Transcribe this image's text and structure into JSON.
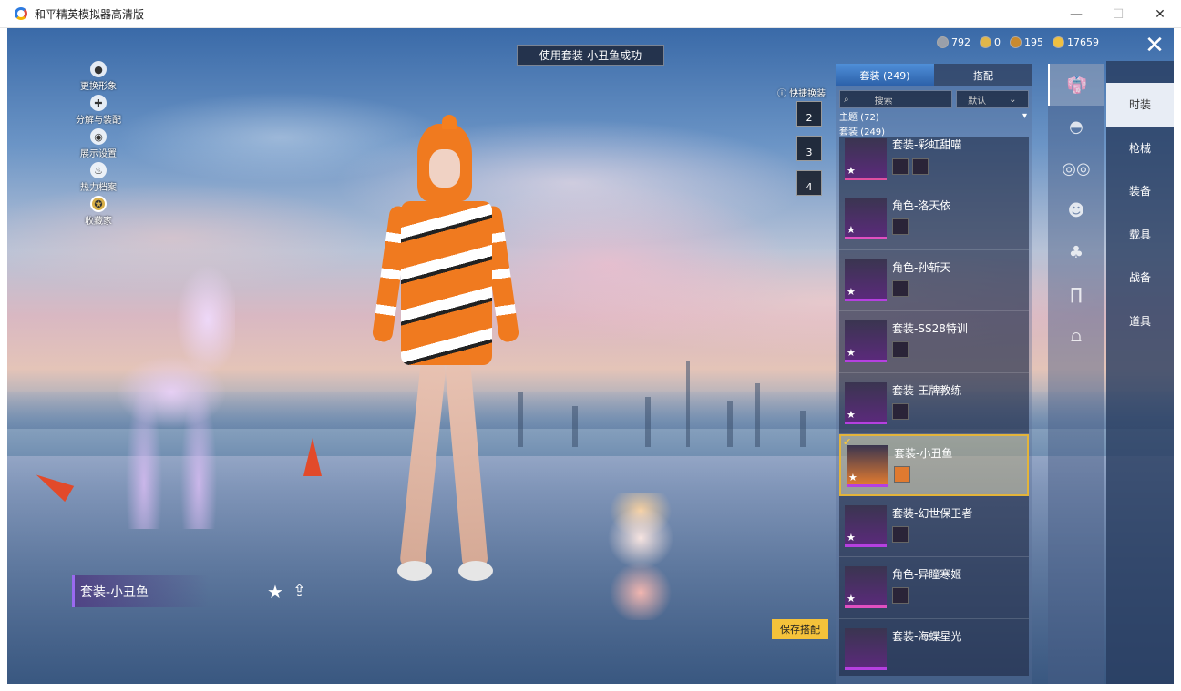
{
  "window": {
    "title": "和平精英模拟器高清版",
    "minimize": "—",
    "maximize": "☐",
    "close": "✕"
  },
  "game": {
    "notice": "使用套装-小丑鱼成功",
    "left_menu": [
      {
        "label": "更换形象",
        "icon": "person-icon"
      },
      {
        "label": "分解与装配",
        "icon": "puzzle-icon"
      },
      {
        "label": "展示设置",
        "icon": "eye-icon"
      },
      {
        "label": "热力档案",
        "icon": "flame-icon"
      },
      {
        "label": "收藏家",
        "icon": "collector-badge-icon"
      }
    ],
    "currency": [
      {
        "value": "792",
        "color": "#9aa0aa"
      },
      {
        "value": "0",
        "color": "#e0b64a"
      },
      {
        "value": "195",
        "color": "#c98a2e"
      },
      {
        "value": "17659",
        "color": "#f0c040"
      }
    ],
    "quick_swap": {
      "label": "快捷换装",
      "slots": [
        "2",
        "3",
        "4"
      ]
    },
    "panel": {
      "tabs": [
        "套装 (249)",
        "搭配"
      ],
      "search_placeholder": "搜索",
      "sort": "默认",
      "section_theme": "主题 (72)",
      "section_suits": "套装 (249)",
      "items": [
        {
          "name": "套装-彩虹甜喵",
          "selected": false
        },
        {
          "name": "角色-洛天依",
          "selected": false
        },
        {
          "name": "角色-孙斩天",
          "selected": false
        },
        {
          "name": "套装-SS28特训",
          "selected": false
        },
        {
          "name": "套装-王牌教练",
          "selected": false
        },
        {
          "name": "套装-小丑鱼",
          "selected": true
        },
        {
          "name": "套装-幻世保卫者",
          "selected": false
        },
        {
          "name": "角色-异瞳寒姬",
          "selected": false
        },
        {
          "name": "套装-海蝶星光",
          "selected": false
        }
      ]
    },
    "categories": [
      "outfit-icon",
      "cap-icon",
      "glasses-icon",
      "mask-icon",
      "top-icon",
      "pants-icon",
      "shoes-icon"
    ],
    "main_tabs": [
      "时装",
      "枪械",
      "装备",
      "载具",
      "战备",
      "道具"
    ],
    "current_outfit": "套装-小丑鱼",
    "save_button": "保存搭配"
  }
}
